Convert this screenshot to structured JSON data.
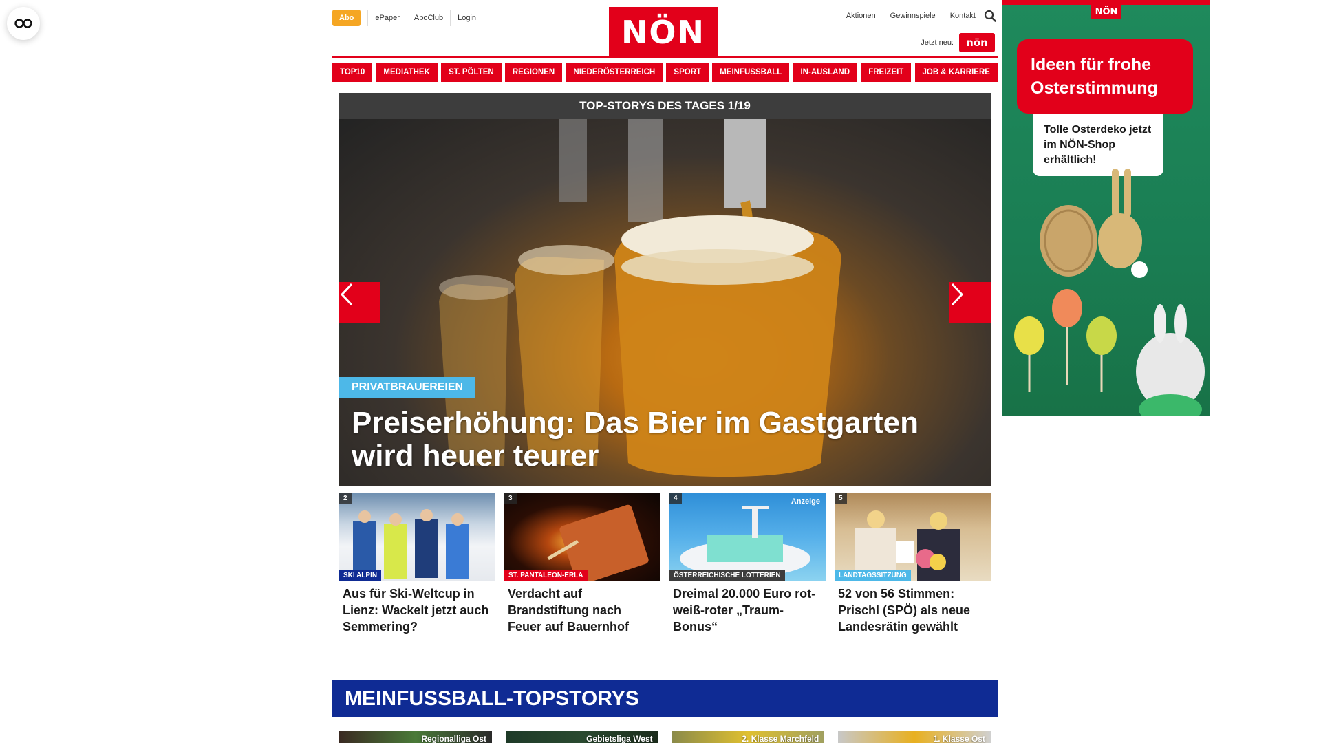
{
  "header": {
    "abo_label": "Abo",
    "util_links": [
      "ePaper",
      "AboClub",
      "Login"
    ],
    "logo_text": "NÖN",
    "right_links": [
      "Aktionen",
      "Gewinnspiele",
      "Kontakt"
    ],
    "jetzt_label": "Jetzt neu:",
    "mini_logo_text": "nön"
  },
  "nav": {
    "items": [
      "TOP10",
      "MEDIATHEK",
      "ST. PÖLTEN",
      "REGIONEN",
      "NIEDERÖSTERREICH",
      "SPORT",
      "MEINFUSSBALL",
      "IN-AUSLAND",
      "FREIZEIT",
      "JOB & KARRIERE"
    ]
  },
  "hero": {
    "header": "TOP-STORYS DES TAGES 1/19",
    "tag": "PRIVATBRAUEREIEN",
    "title": "Preiserhöhung: Das Bier im Gastgarten wird heuer teurer"
  },
  "teasers": [
    {
      "num": "2",
      "tag": "SKI ALPIN",
      "tag_color": "#0f2b94",
      "title": "Aus für Ski-Weltcup in Lienz: Wackelt jetzt auch Semmering?"
    },
    {
      "num": "3",
      "tag": "ST. PANTALEON-ERLA",
      "tag_color": "#e2001a",
      "title": "Verdacht auf Brandstiftung nach Feuer auf Bauernhof"
    },
    {
      "num": "4",
      "ad": "Anzeige",
      "tag": "ÖSTERREICHISCHE LOTTERIEN",
      "tag_color": "#3d3d3d",
      "title": "Dreimal 20.000 Euro rot-weiß-roter „Traum-Bonus“"
    },
    {
      "num": "5",
      "tag": "LANDTAGSSITZUNG",
      "tag_color": "#4db8e8",
      "title": "52 von 56 Stimmen: Prischl (SPÖ) als neue Landesrätin gewählt"
    }
  ],
  "section": {
    "title": "MEINFUSSBALL-TOPSTORYS",
    "cards": [
      "Regionalliga Ost",
      "Gebietsliga West",
      "2. Klasse Marchfeld",
      "1. Klasse Ost"
    ]
  },
  "ad": {
    "logo": "NÖN",
    "headline": "Ideen für frohe Osterstimmung",
    "subtext": "Tolle Osterdeko jetzt im NÖN-Shop erhältlich!"
  }
}
